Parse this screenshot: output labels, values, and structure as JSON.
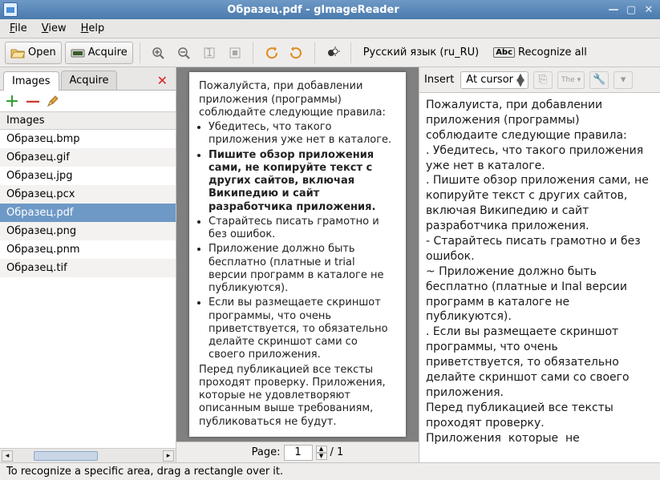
{
  "window": {
    "title": "Образец.pdf - gImageReader"
  },
  "menu": {
    "file": "File",
    "view": "View",
    "help": "Help"
  },
  "toolbar": {
    "open": "Open",
    "acquire": "Acquire",
    "language": "Русский язык (ru_RU)",
    "recognize_all": "Recognize all"
  },
  "sidebar": {
    "tabs": {
      "images": "Images",
      "acquire": "Acquire"
    },
    "heading": "Images",
    "files": [
      "Образец.bmp",
      "Образец.gif",
      "Образец.jpg",
      "Образец.pcx",
      "Образец.pdf",
      "Образец.png",
      "Образец.pnm",
      "Образец.tif"
    ],
    "selected_index": 4
  },
  "pager": {
    "label": "Page:",
    "current": "1",
    "total": "/ 1"
  },
  "right": {
    "insert_label": "Insert",
    "mode": "At cursor",
    "mini1": "⎘",
    "mini2": "The ▾",
    "mini3": "🔧",
    "text": "Пожалуиста, при добавлении приложения (программы) соблюдаите следующие правила:\n. Убедитесь, что такого приложения уже нет в каталоге.\n. Пишите обзор приложения сами, не копируйте текст с других сайтов, включая Википедию и сайт разработчика приложения.\n- Старайтесь писать грамотно и без ошибок.\n~ Приложение должно быть бесплатно (платные и Iпаl версии программ в каталоге не публикуются).\n. Если вы размещаете скриншот программы, что очень приветствуется, то обязательно делайте скриншот сами со своего приложения.\nПеред публикацией все тексты проходят проверку.\nПриложения  которые  не"
  },
  "page_doc": {
    "intro": "Пожалуйста, при добавлении приложения (программы) соблюдайте следующие правила:",
    "b1": "Убедитесь, что такого приложения уже нет в каталоге.",
    "b2": "Пишите обзор приложения сами, не копируйте текст с других сайтов, включая Википедию и сайт разработчика приложения.",
    "b3": "Старайтесь писать грамотно и без ошибок.",
    "b4": "Приложение должно быть бесплатно (платные и trial версии программ в каталоге не публикуются).",
    "b5": "Если вы размещаете скриншот программы, что очень приветствуется, то обязательно делайте скриншот сами со своего приложения.",
    "outro": "Перед публикацией все тексты проходят проверку. Приложения, которые не удовлетворяют описанным выше требованиям, публиковаться не будут."
  },
  "status": {
    "text": "To recognize a specific area, drag a rectangle over it."
  }
}
